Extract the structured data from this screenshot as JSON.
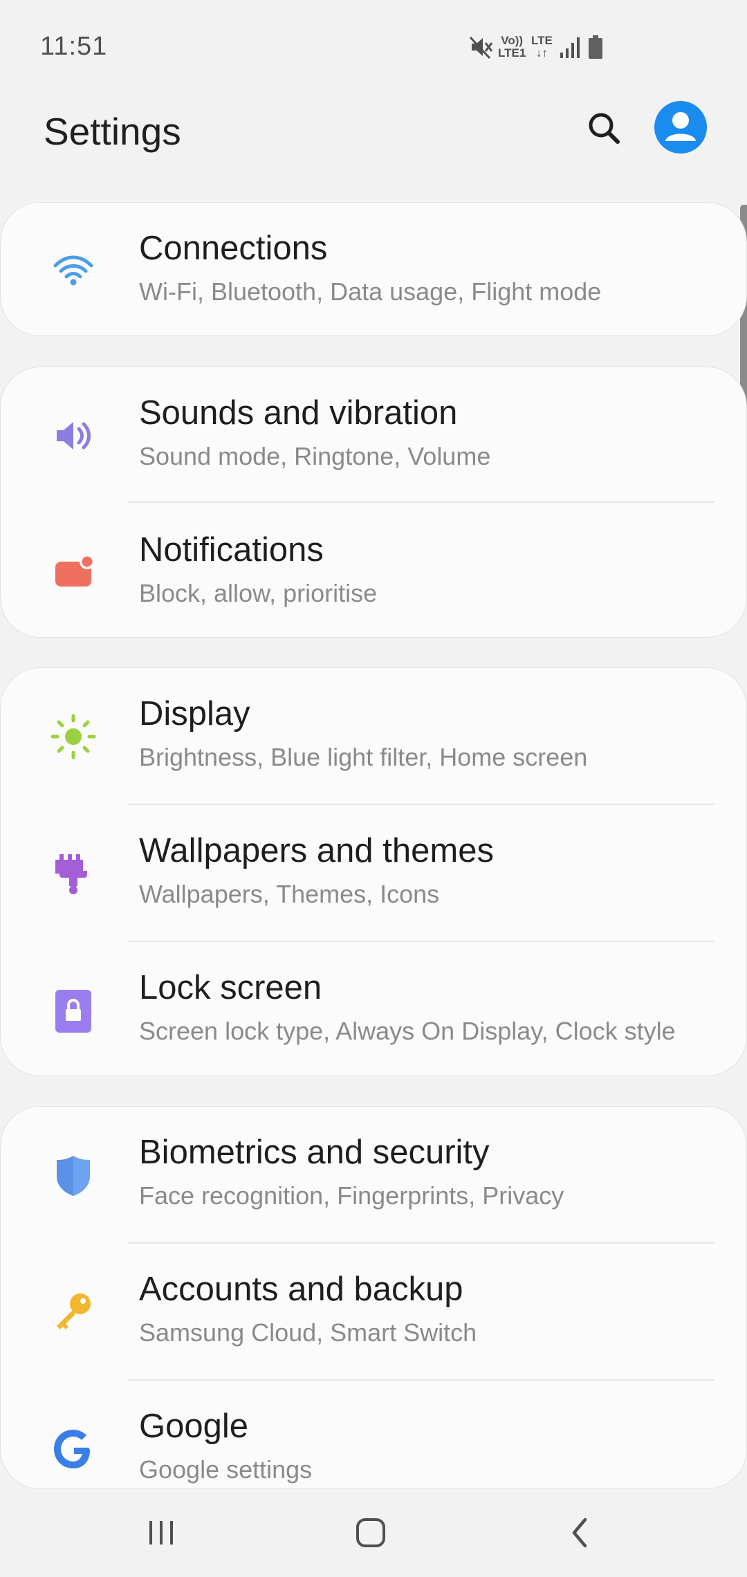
{
  "status_bar": {
    "time": "11:51",
    "volte_line1": "Vo))",
    "volte_line2": "LTE1",
    "lte_line1": "LTE",
    "lte_line2": "↓↑",
    "icons": [
      "mute-icon",
      "volte-indicator",
      "lte-indicator",
      "signal-icon",
      "battery-icon"
    ]
  },
  "header": {
    "title": "Settings",
    "search_icon": "search-icon",
    "profile_icon": "profile-icon",
    "accent_color": "#1a8cf0"
  },
  "groups": [
    {
      "items": [
        {
          "title": "Connections",
          "subtitle": "Wi-Fi, Bluetooth, Data usage, Flight mode",
          "icon": "wifi-icon",
          "icon_color": "#4a9de8"
        }
      ]
    },
    {
      "items": [
        {
          "title": "Sounds and vibration",
          "subtitle": "Sound mode, Ringtone, Volume",
          "icon": "speaker-icon",
          "icon_color": "#8a7ee0"
        },
        {
          "title": "Notifications",
          "subtitle": "Block, allow, prioritise",
          "icon": "notification-icon",
          "icon_color": "#f0705f"
        }
      ]
    },
    {
      "items": [
        {
          "title": "Display",
          "subtitle": "Brightness, Blue light filter, Home screen",
          "icon": "sun-icon",
          "icon_color": "#9bd040"
        },
        {
          "title": "Wallpapers and themes",
          "subtitle": "Wallpapers, Themes, Icons",
          "icon": "paintbrush-icon",
          "icon_color": "#a45ed6"
        },
        {
          "title": "Lock screen",
          "subtitle": "Screen lock type, Always On Display, Clock style",
          "icon": "lock-icon",
          "icon_color": "#9a7ef0"
        }
      ]
    },
    {
      "items": [
        {
          "title": "Biometrics and security",
          "subtitle": "Face recognition, Fingerprints, Privacy",
          "icon": "shield-icon",
          "icon_color": "#6fa2f0"
        },
        {
          "title": "Accounts and backup",
          "subtitle": "Samsung Cloud, Smart Switch",
          "icon": "key-icon",
          "icon_color": "#f2b630"
        },
        {
          "title": "Google",
          "subtitle": "Google settings",
          "icon": "google-icon",
          "icon_color": "#3a7ee8"
        }
      ]
    }
  ],
  "nav_bar": {
    "buttons": [
      "recent-apps-icon",
      "home-icon",
      "back-icon"
    ]
  }
}
